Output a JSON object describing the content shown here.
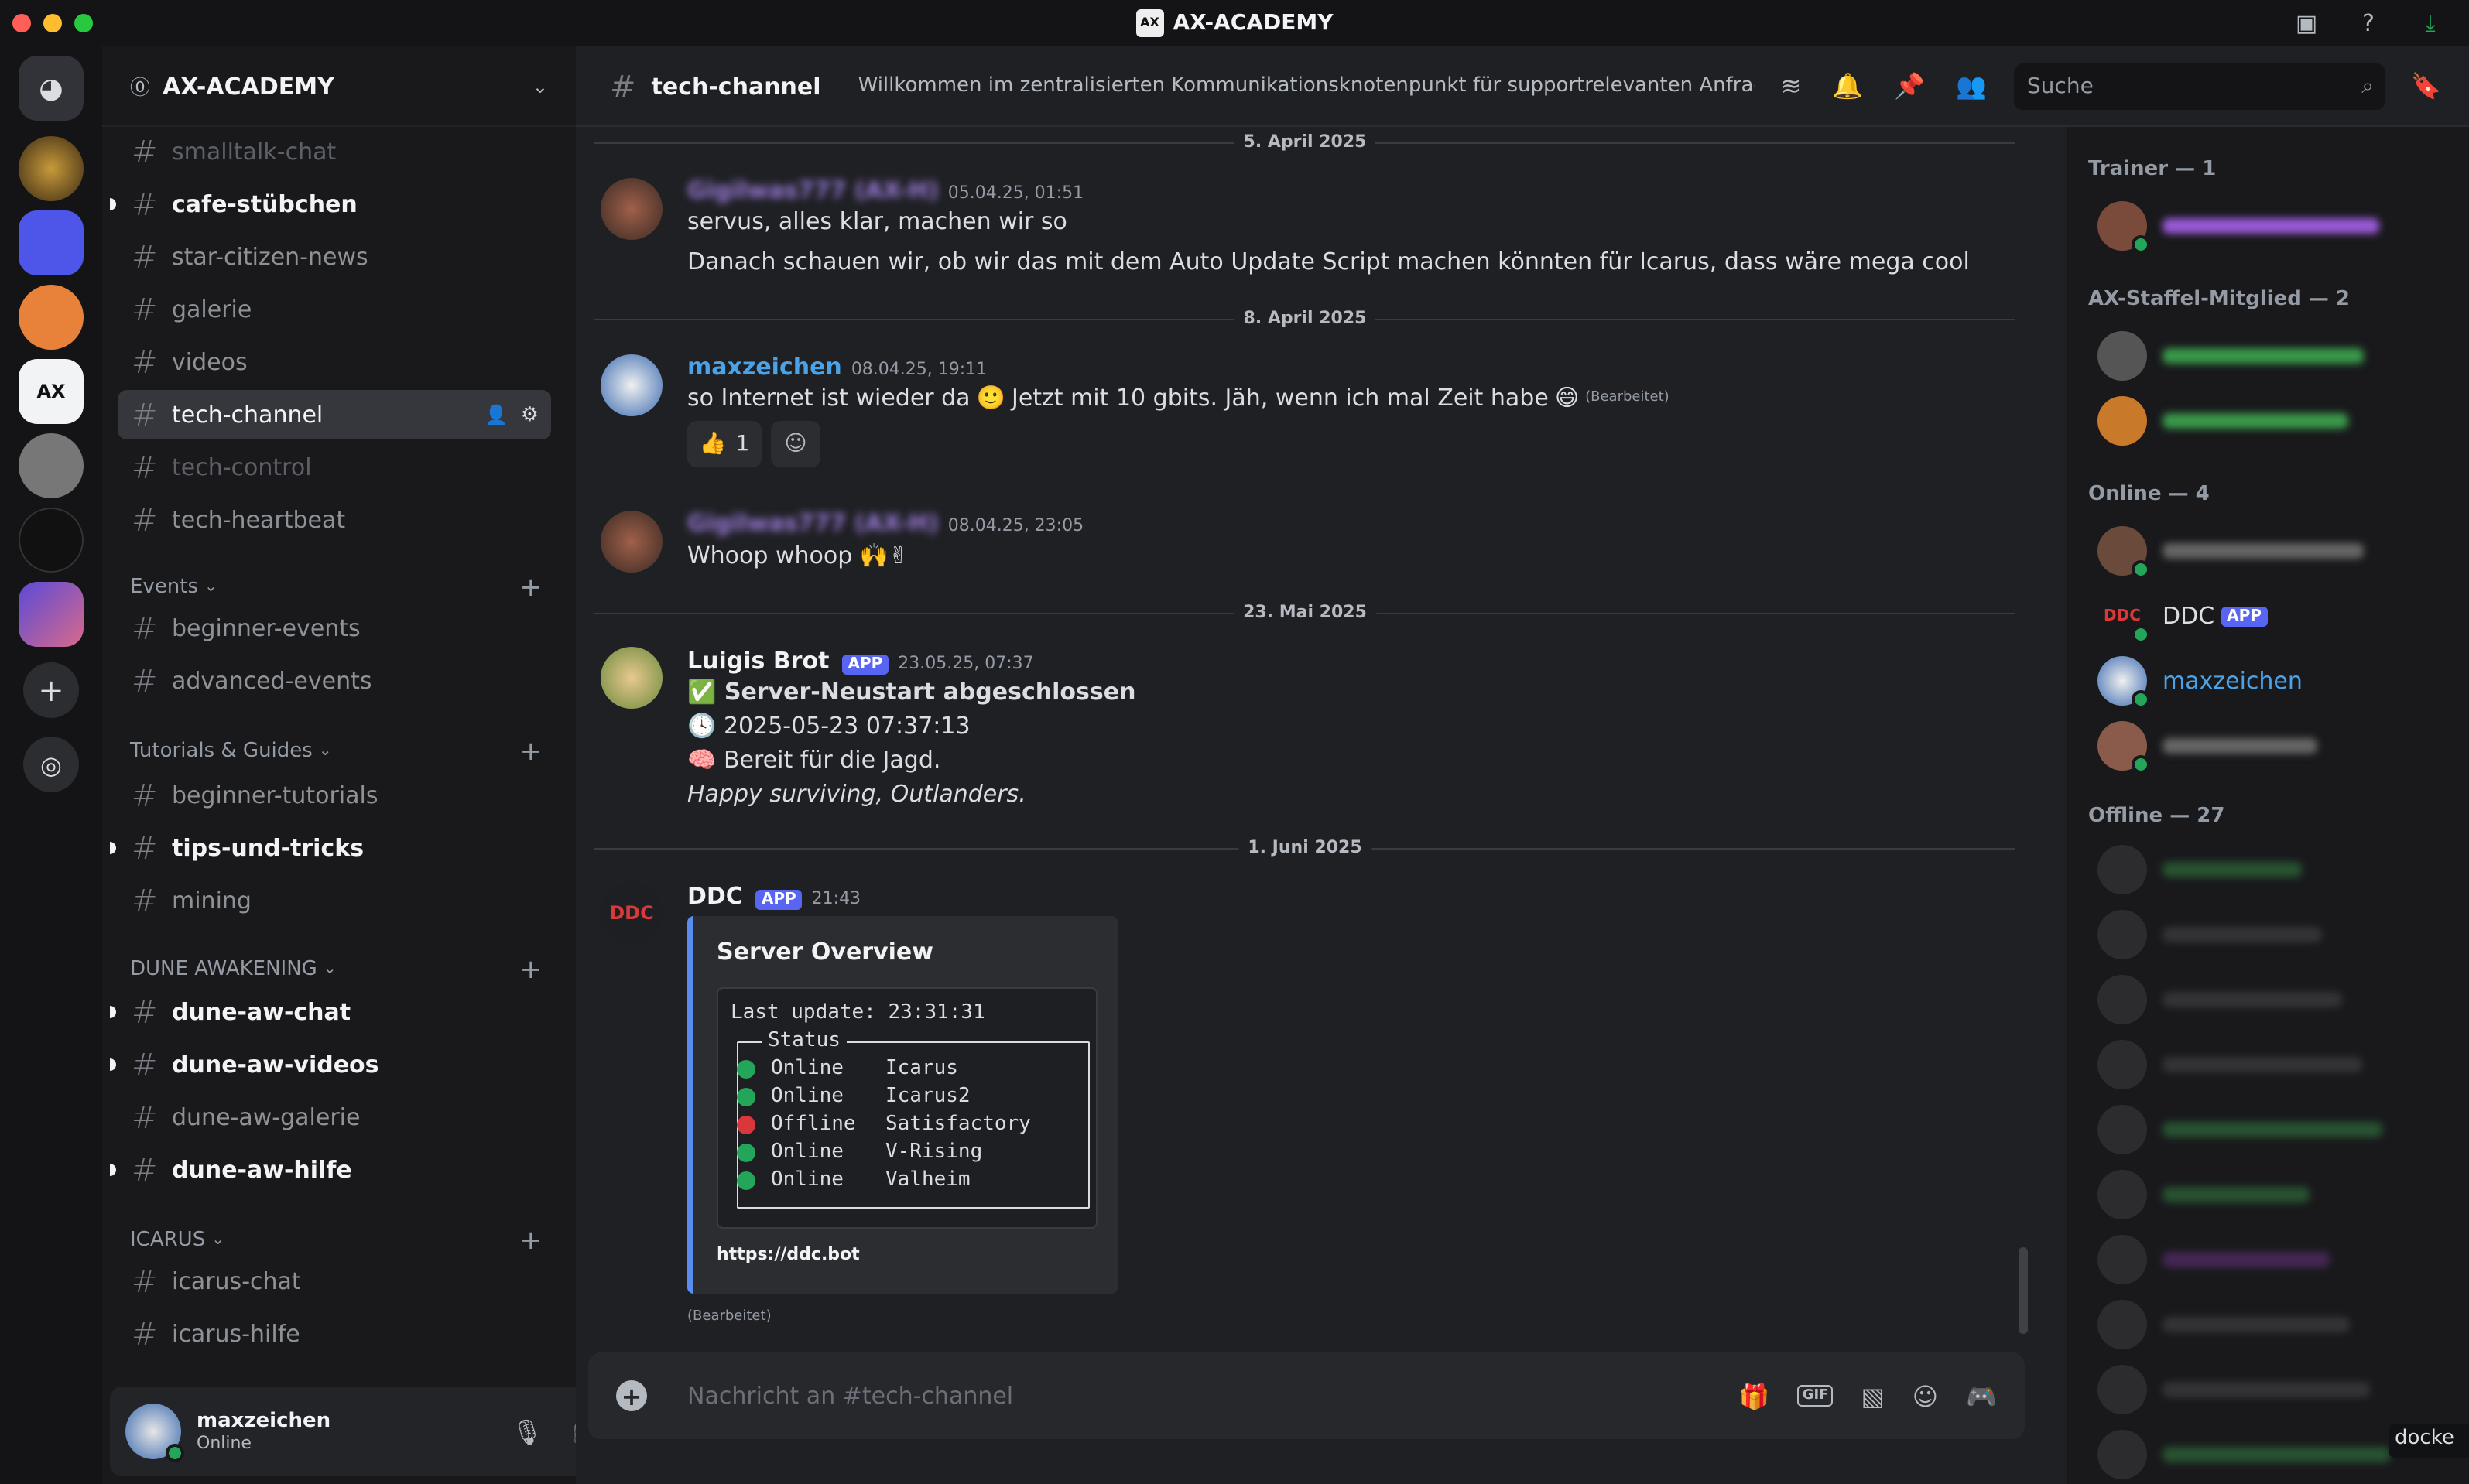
{
  "window": {
    "title": "AX-ACADEMY",
    "logo_text": "AX"
  },
  "server": {
    "name": "AX-ACADEMY"
  },
  "channels": [
    {
      "name": "smalltalk-chat",
      "state": "muted"
    },
    {
      "name": "cafe-stübchen",
      "state": "unread"
    },
    {
      "name": "star-citizen-news",
      "state": "normal"
    },
    {
      "name": "galerie",
      "state": "normal"
    },
    {
      "name": "videos",
      "state": "normal"
    },
    {
      "name": "tech-channel",
      "state": "active"
    },
    {
      "name": "tech-control",
      "state": "muted"
    },
    {
      "name": "tech-heartbeat",
      "state": "normal"
    }
  ],
  "categories": [
    {
      "name": "Events",
      "channels": [
        "beginner-events",
        "advanced-events"
      ]
    },
    {
      "name": "Tutorials & Guides",
      "channels": [
        "beginner-tutorials",
        "tips-und-tricks",
        "mining"
      ]
    },
    {
      "name": "DUNE AWAKENING",
      "channels": [
        "dune-aw-chat",
        "dune-aw-videos",
        "dune-aw-galerie",
        "dune-aw-hilfe"
      ]
    },
    {
      "name": "ICARUS",
      "channels": [
        "icarus-chat",
        "icarus-hilfe"
      ]
    }
  ],
  "user": {
    "name": "maxzeichen",
    "status": "Online"
  },
  "header": {
    "channel": "tech-channel",
    "topic": "Willkommen im zentralisierten Kommunikationsknotenpunkt für supportrelevanten Anfragen im...",
    "search_placeholder": "Suche"
  },
  "dates": {
    "d1": "5. April 2025",
    "d2": "8. April 2025",
    "d3": "23. Mai 2025",
    "d4": "1. Juni 2025"
  },
  "messages": {
    "m1": {
      "author": "Gigilwas777 (AX-H)",
      "time": "05.04.25, 01:51",
      "line1": "servus, alles klar, machen wir so",
      "line2": "Danach schauen wir, ob wir das mit dem Auto Update Script machen könnten für Icarus, dass wäre mega cool"
    },
    "m2": {
      "author": "maxzeichen",
      "time": "08.04.25, 19:11",
      "text_a": "so Internet ist wieder da",
      "text_b": "Jetzt mit 10 gbits. Jäh, wenn ich mal Zeit habe",
      "edited": "(Bearbeitet)",
      "reaction_count": "1"
    },
    "m3": {
      "author": "Gigilwas777 (AX-H)",
      "time": "08.04.25, 23:05",
      "text": "Whoop whoop 🙌✌"
    },
    "m4": {
      "author": "Luigis Brot",
      "tag": "APP",
      "time": "23.05.25, 07:37",
      "l1": "Server-Neustart abgeschlossen",
      "l2": "2025-05-23 07:37:13",
      "l3": "Bereit für die Jagd.",
      "l4": "Happy surviving, Outlanders."
    },
    "m5": {
      "author": "DDC",
      "tag": "APP",
      "time": "21:43",
      "embed_title": "Server Overview",
      "last_update": "Last update: 23:31:31",
      "status_label": "Status",
      "link": "https://ddc.bot",
      "edited": "(Bearbeitet)",
      "avatar_text": "DDC"
    }
  },
  "servers_status": [
    {
      "state": "Online",
      "name": "Icarus",
      "color": "#23a55a"
    },
    {
      "state": "Online",
      "name": "Icarus2",
      "color": "#23a55a"
    },
    {
      "state": "Offline",
      "name": "Satisfactory",
      "color": "#da373c"
    },
    {
      "state": "Online",
      "name": "V-Rising",
      "color": "#23a55a"
    },
    {
      "state": "Online",
      "name": "Valheim",
      "color": "#23a55a"
    }
  ],
  "composer": {
    "placeholder": "Nachricht an #tech-channel"
  },
  "members": {
    "trainer": "Trainer — 1",
    "staffel": "AX-Staffel-Mitglied — 2",
    "online": "Online — 4",
    "offline": "Offline — 27",
    "ddc": "DDC",
    "ddc_tag": "APP",
    "max": "maxzeichen",
    "tooltip": "docke"
  }
}
